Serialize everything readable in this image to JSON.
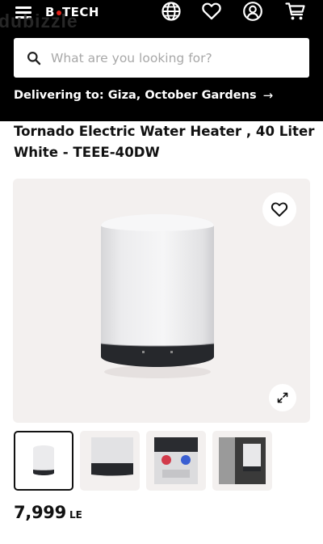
{
  "header": {
    "logo_text_before_dot": "B",
    "logo_text_after_dot": "TECH",
    "watermark": "dubizzle",
    "icons": [
      "menu-icon",
      "globe-icon",
      "heart-icon",
      "account-icon",
      "cart-icon"
    ],
    "accent_color": "#e2231a"
  },
  "search": {
    "placeholder": "What are you looking for?",
    "value": ""
  },
  "delivery": {
    "label": "Delivering to: Giza, October Gardens",
    "arrow": "→"
  },
  "product": {
    "title": "Tornado Electric Water Heater , 40 Liter White - TEEE-40DW",
    "price": "7,999",
    "currency": "LE",
    "thumbnail_count": 4,
    "active_thumbnail": 1
  }
}
